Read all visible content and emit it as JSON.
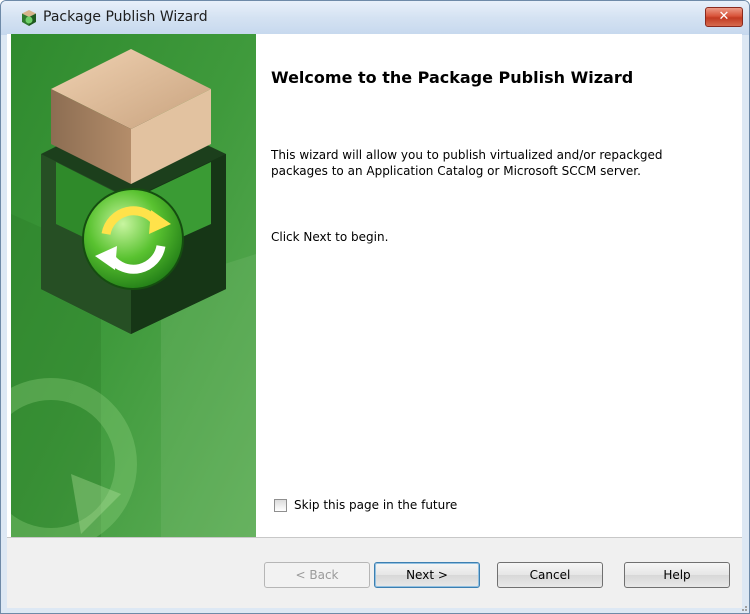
{
  "window": {
    "title": "Package Publish Wizard",
    "close_symbol": "✕",
    "icon": "package-icon"
  },
  "colors": {
    "side_panel_green": "#3f9a3c",
    "title_bar": "#d4e2f2",
    "close_red": "#c94a32"
  },
  "main": {
    "heading": "Welcome to the Package Publish Wizard",
    "description": "This wizard will allow you to publish virtualized and/or repackged packages to an Application Catalog or Microsoft SCCM server.",
    "hint": "Click Next to begin.",
    "skip_label": "Skip this page in the future",
    "skip_checked": false
  },
  "buttons": {
    "back": "< Back",
    "next": "Next >",
    "cancel": "Cancel",
    "help": "Help"
  }
}
